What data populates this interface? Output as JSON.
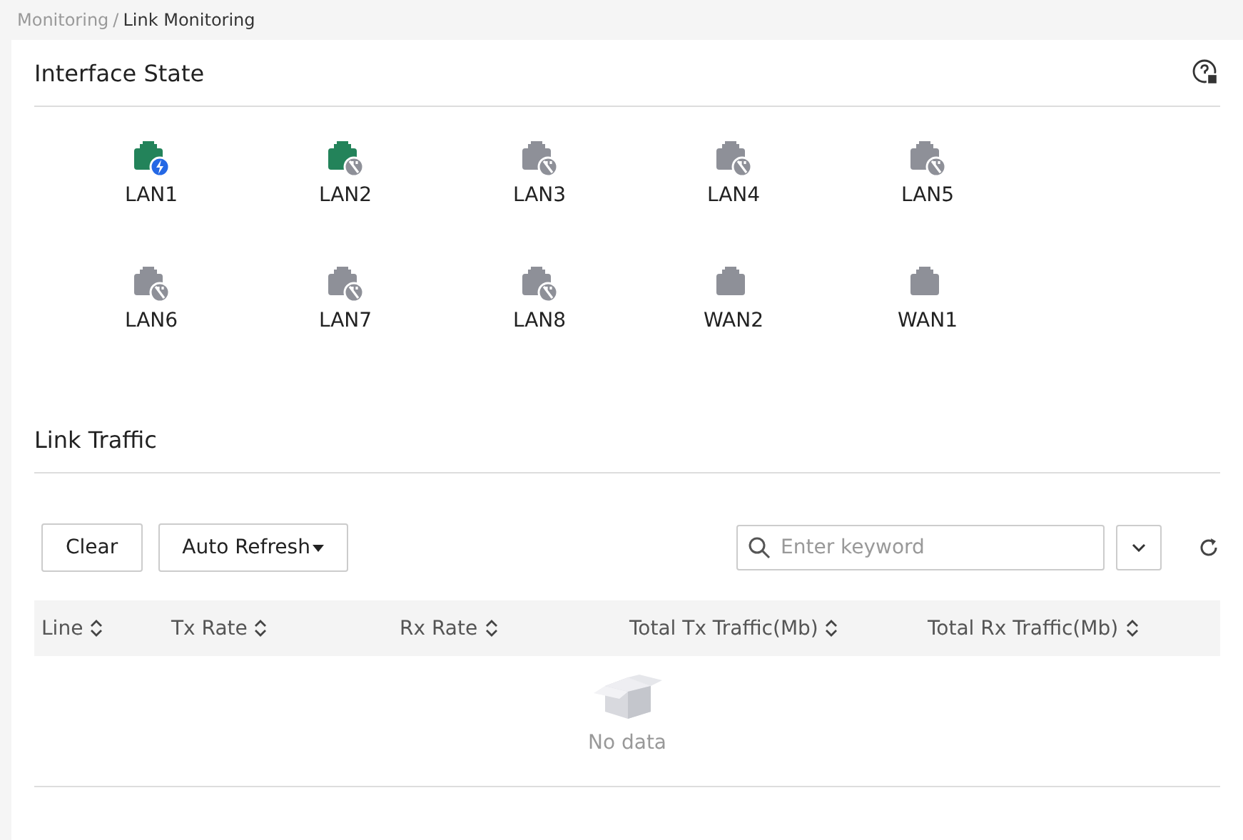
{
  "breadcrumb": {
    "items": [
      "Monitoring",
      "Link Monitoring"
    ],
    "separator": "/"
  },
  "interface_state": {
    "title": "Interface State",
    "ports": [
      {
        "label": "LAN1",
        "linked": true,
        "kind": "active"
      },
      {
        "label": "LAN2",
        "linked": true,
        "kind": "unplugged"
      },
      {
        "label": "LAN3",
        "linked": false,
        "kind": "unplugged"
      },
      {
        "label": "LAN4",
        "linked": false,
        "kind": "unplugged"
      },
      {
        "label": "LAN5",
        "linked": false,
        "kind": "unplugged"
      },
      {
        "label": "LAN6",
        "linked": false,
        "kind": "unplugged"
      },
      {
        "label": "LAN7",
        "linked": false,
        "kind": "unplugged"
      },
      {
        "label": "LAN8",
        "linked": false,
        "kind": "unplugged"
      },
      {
        "label": "WAN2",
        "linked": false,
        "kind": "plain"
      },
      {
        "label": "WAN1",
        "linked": false,
        "kind": "plain"
      }
    ]
  },
  "link_traffic": {
    "title": "Link Traffic",
    "buttons": [
      "Clear",
      "Auto Refresh"
    ],
    "search": {
      "placeholder": "Enter keyword"
    },
    "table": {
      "columns": [
        "Line",
        "Tx Rate",
        "Rx Rate",
        "Total Tx Traffic(Mb)",
        "Total Rx Traffic(Mb)"
      ],
      "empty_text": "No data"
    }
  }
}
